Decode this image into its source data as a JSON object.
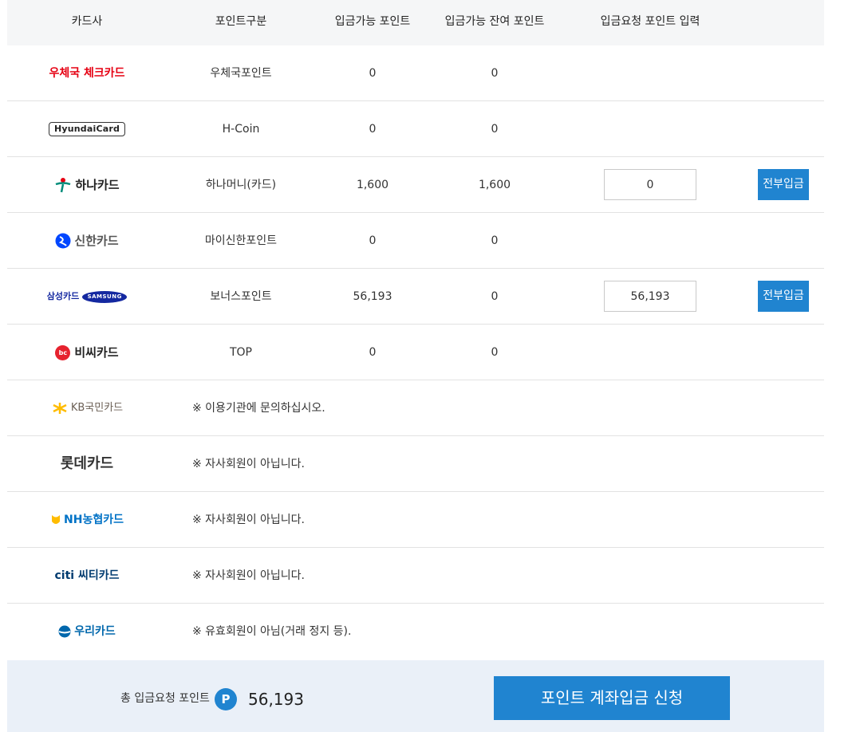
{
  "header": {
    "card_company": "카드사",
    "point_type": "포인트구분",
    "available_points": "입금가능 포인트",
    "remaining_points": "입금가능 잔여 포인트",
    "request_input": "입금요청 포인트 입력"
  },
  "rows": [
    {
      "card": "우체국 체크카드",
      "point_type": "우체국포인트",
      "available": "0",
      "remaining": "0"
    },
    {
      "card": "HyundaiCard",
      "point_type": "H-Coin",
      "available": "0",
      "remaining": "0"
    },
    {
      "card": "하나카드",
      "point_type": "하나머니(카드)",
      "available": "1,600",
      "remaining": "1,600",
      "input_value": "0",
      "button_label": "전부입금"
    },
    {
      "card": "신한카드",
      "point_type": "마이신한포인트",
      "available": "0",
      "remaining": "0"
    },
    {
      "card": "삼성카드",
      "card_sub": "SAMSUNG",
      "point_type": "보너스포인트",
      "available": "56,193",
      "remaining": "0",
      "input_value": "56,193",
      "button_label": "전부입금"
    },
    {
      "card": "비씨카드",
      "point_type": "TOP",
      "available": "0",
      "remaining": "0"
    },
    {
      "card": "KB국민카드",
      "note": "※ 이용기관에 문의하십시오."
    },
    {
      "card": "롯데카드",
      "note": "※ 자사회원이 아닙니다."
    },
    {
      "card": "NH농협카드",
      "note": "※ 자사회원이 아닙니다."
    },
    {
      "card": "citi 씨티카드",
      "note": "※ 자사회원이 아닙니다."
    },
    {
      "card": "우리카드",
      "note": "※ 유효회원이 아님(거래 정지 등)."
    }
  ],
  "footer": {
    "total_label": "총 입금요청 포인트",
    "point_icon": "P",
    "total_value": "56,193",
    "submit_label": "포인트 계좌입금 신청"
  },
  "colors": {
    "accent": "#2084d0",
    "header_bg": "#f5f6f7",
    "footer_bg": "#eaf0f8",
    "epost_red": "#e60012",
    "hana_green": "#008c7a",
    "shinhan_blue": "#0046ff",
    "kb_yellow": "#ffbc00",
    "nh_blue": "#0072c6",
    "citi_blue": "#003b70",
    "woori_blue": "#0067ac"
  }
}
